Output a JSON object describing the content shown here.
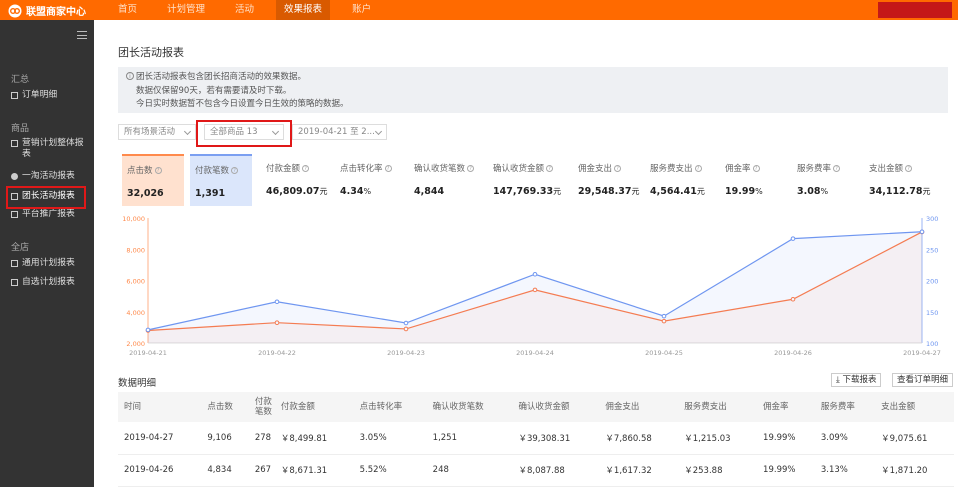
{
  "app": {
    "logo_text": "联盟商家中心"
  },
  "nav": [
    "首页",
    "计划管理",
    "活动",
    "效果报表",
    "账户"
  ],
  "nav_active": 3,
  "sidebar": {
    "groups": [
      {
        "label": "汇总",
        "items": [
          {
            "label": "订单明细",
            "icon": "list-icon"
          }
        ]
      },
      {
        "label": "商品",
        "items": [
          {
            "label": "营销计划整体报表",
            "icon": "gift-icon"
          },
          {
            "label": "一淘活动报表",
            "icon": "etao-icon"
          },
          {
            "label": "团长活动报表",
            "icon": "home-icon"
          },
          {
            "label": "平台推广报表",
            "icon": "share-icon"
          }
        ]
      },
      {
        "label": "全店",
        "items": [
          {
            "label": "通用计划报表",
            "icon": "image-icon"
          },
          {
            "label": "自选计划报表",
            "icon": "people-icon"
          }
        ]
      }
    ]
  },
  "page": {
    "title": "团长活动报表",
    "notice": [
      "团长活动报表包含团长招商活动的效果数据。",
      "数据仅保留90天，若有需要请及时下载。",
      "今日实时数据暂不包含今日设置今日生效的策略的数据。"
    ],
    "filters": {
      "scene": "所有场景活动",
      "goods": "全部商品 13",
      "date": "2019-04-21 至 2..."
    }
  },
  "metrics": [
    {
      "label": "点击数",
      "value": "32,026",
      "unit": ""
    },
    {
      "label": "付款笔数",
      "value": "1,391",
      "unit": ""
    },
    {
      "label": "付款金额",
      "value": "46,809.07",
      "unit": "元"
    },
    {
      "label": "点击转化率",
      "value": "4.34",
      "unit": "%"
    },
    {
      "label": "确认收货笔数",
      "value": "4,844",
      "unit": ""
    },
    {
      "label": "确认收货金额",
      "value": "147,769.33",
      "unit": "元"
    },
    {
      "label": "佣金支出",
      "value": "29,548.37",
      "unit": "元"
    },
    {
      "label": "服务费支出",
      "value": "4,564.41",
      "unit": "元"
    },
    {
      "label": "佣金率",
      "value": "19.99",
      "unit": "%"
    },
    {
      "label": "服务费率",
      "value": "3.08",
      "unit": "%"
    },
    {
      "label": "支出金额",
      "value": "34,112.78",
      "unit": "元"
    }
  ],
  "chart_data": {
    "type": "line",
    "x": [
      "2019-04-21",
      "2019-04-22",
      "2019-04-23",
      "2019-04-24",
      "2019-04-25",
      "2019-04-26",
      "2019-04-27"
    ],
    "y_left_ticks": [
      "10,000",
      "8,000",
      "6,000",
      "4,000",
      "2,000"
    ],
    "y_right_ticks": [
      "300",
      "250",
      "200",
      "150",
      "100"
    ],
    "y_left_range": [
      2000,
      10000
    ],
    "y_right_range": [
      100,
      300
    ],
    "series": [
      {
        "name": "点击数",
        "axis": "left",
        "color": "#ff7a45",
        "values": [
          2800,
          3300,
          2900,
          5400,
          3400,
          4800,
          9106
        ]
      },
      {
        "name": "付款笔数",
        "axis": "right",
        "color": "#6f96f0",
        "values": [
          121,
          166,
          132,
          210,
          143,
          267,
          278
        ]
      }
    ]
  },
  "detail": {
    "title": "数据明细",
    "download": "下载报表",
    "view_orders": "查看订单明细",
    "columns": [
      "时间",
      "点击数",
      "付款笔数",
      "付款金额",
      "点击转化率",
      "确认收货笔数",
      "确认收货金额",
      "佣金支出",
      "服务费支出",
      "佣金率",
      "服务费率",
      "支出金额"
    ],
    "rows": [
      [
        "2019-04-27",
        "9,106",
        "278",
        "￥8,499.81",
        "3.05%",
        "1,251",
        "￥39,308.31",
        "￥7,860.58",
        "￥1,215.03",
        "19.99%",
        "3.09%",
        "￥9,075.61"
      ],
      [
        "2019-04-26",
        "4,834",
        "267",
        "￥8,671.31",
        "5.52%",
        "248",
        "￥8,087.88",
        "￥1,617.32",
        "￥253.88",
        "19.99%",
        "3.13%",
        "￥1,871.20"
      ]
    ]
  }
}
